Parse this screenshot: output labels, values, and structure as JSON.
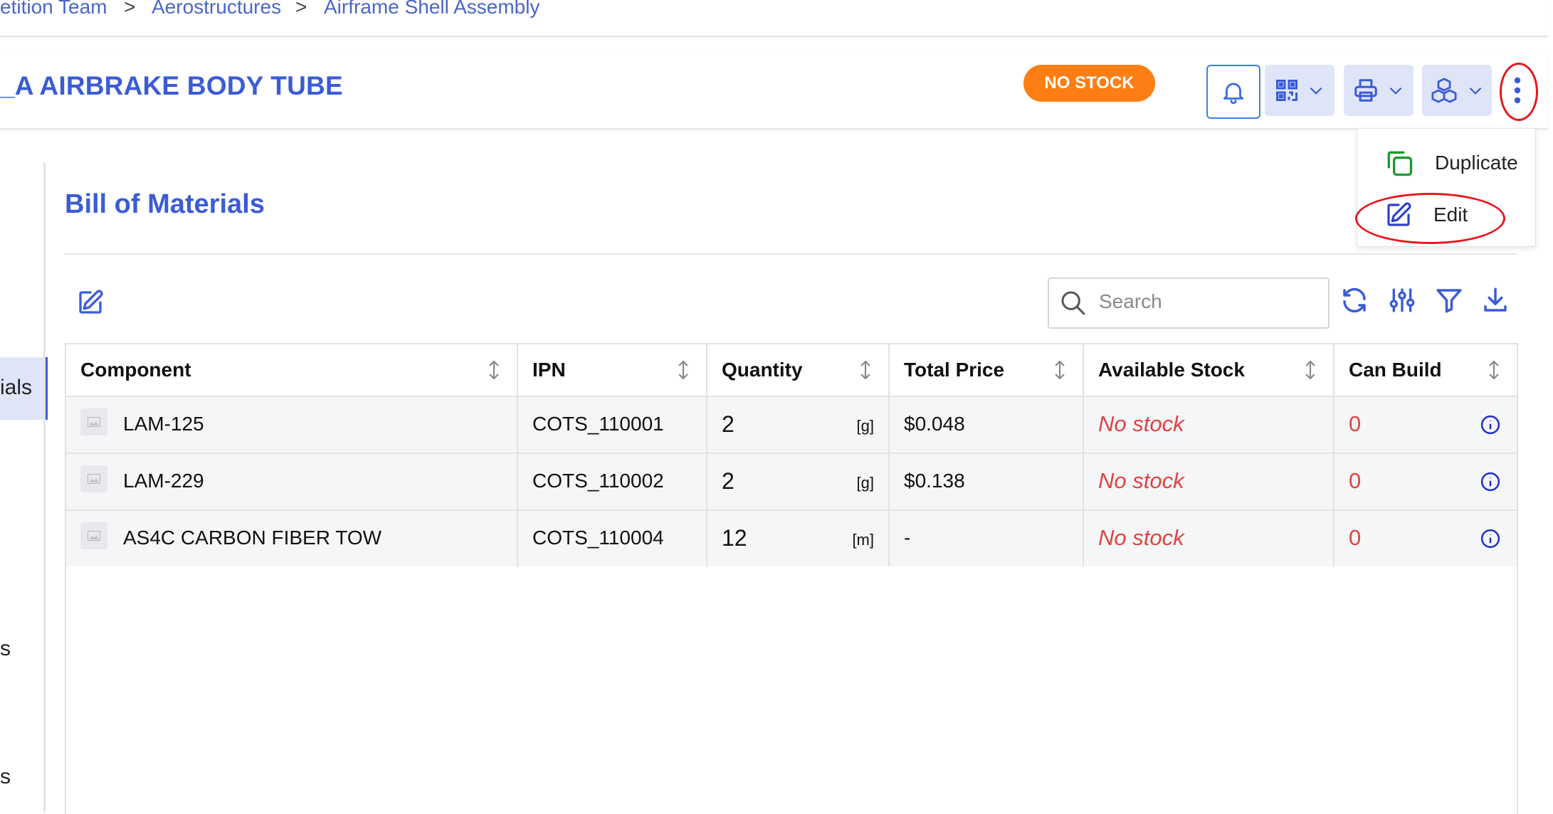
{
  "breadcrumb": {
    "items": [
      "etition Team",
      "Aerostructures",
      "Airframe Shell Assembly"
    ],
    "separator": ">"
  },
  "part": {
    "title": "_A AIRBRAKE BODY TUBE",
    "badge": "NO STOCK"
  },
  "menu": {
    "duplicate_label": "Duplicate",
    "edit_label": "Edit"
  },
  "sidebar": {
    "active_label": "ials",
    "fragment_1": "s",
    "fragment_2": "s"
  },
  "bom": {
    "section_title": "Bill of Materials",
    "search_placeholder": "Search",
    "columns": [
      "Component",
      "IPN",
      "Quantity",
      "Total Price",
      "Available Stock",
      "Can Build"
    ],
    "rows": [
      {
        "component": "LAM-125",
        "ipn": "COTS_110001",
        "quantity": "2",
        "unit": "[g]",
        "total_price": "$0.048",
        "available_stock": "No stock",
        "can_build": "0"
      },
      {
        "component": "LAM-229",
        "ipn": "COTS_110002",
        "quantity": "2",
        "unit": "[g]",
        "total_price": "$0.138",
        "available_stock": "No stock",
        "can_build": "0"
      },
      {
        "component": "AS4C CARBON FIBER TOW",
        "ipn": "COTS_110004",
        "quantity": "12",
        "unit": "[m]",
        "total_price": "-",
        "available_stock": "No stock",
        "can_build": "0"
      }
    ]
  },
  "colors": {
    "accent": "#3b5bd6",
    "badge": "#fd7e14",
    "danger": "#e0433f",
    "duplicate_icon": "#1a9a2e",
    "annotation": "#e8161c"
  },
  "icons": [
    "bell-icon",
    "qr-code-icon",
    "printer-icon",
    "cubes-icon",
    "more-vertical-icon",
    "duplicate-icon",
    "edit-icon",
    "search-icon",
    "refresh-icon",
    "sliders-icon",
    "filter-icon",
    "download-icon",
    "sort-icon",
    "image-placeholder-icon",
    "info-icon"
  ]
}
